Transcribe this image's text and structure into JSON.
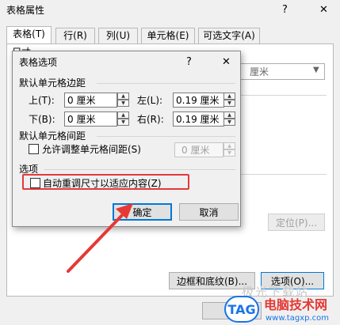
{
  "outer": {
    "title": "表格属性",
    "help_glyph": "?",
    "close_glyph": "✕",
    "tabs": [
      {
        "label": "表格(T)"
      },
      {
        "label": "行(R)"
      },
      {
        "label": "列(U)"
      },
      {
        "label": "单元格(E)"
      },
      {
        "label": "可选文字(A)"
      }
    ],
    "size_label": "尺寸",
    "unit_value": "厘米",
    "position_button": "定位(P)...",
    "borders_button": "边框和底纹(B)...",
    "options_button": "选项(O)..."
  },
  "dialog": {
    "title": "表格选项",
    "help_glyph": "?",
    "close_glyph": "✕",
    "margins_group": "默认单元格边距",
    "top_label": "上(T):",
    "top_value": "0 厘米",
    "left_label": "左(L):",
    "left_value": "0.19 厘米",
    "bottom_label": "下(B):",
    "bottom_value": "0 厘米",
    "right_label": "右(R):",
    "right_value": "0.19 厘米",
    "spacing_group": "默认单元格间距",
    "spacing_checkbox_label": "允许调整单元格间距(S)",
    "spacing_value": "0 厘米",
    "options_group": "选项",
    "autofit_label": "自动重调尺寸以适应内容(Z)",
    "ok_button": "确定",
    "cancel_button": "取消"
  },
  "watermark": {
    "logo_text": "TAG",
    "site_name": "电脑技术网",
    "site_url": "www.tagxp.com",
    "faded_text": "极光下载站"
  },
  "colors": {
    "highlight_red": "#e5383b",
    "arrow_red": "#e53935",
    "focus_blue": "#0078d7",
    "watermark_blue": "#1a73e8"
  }
}
